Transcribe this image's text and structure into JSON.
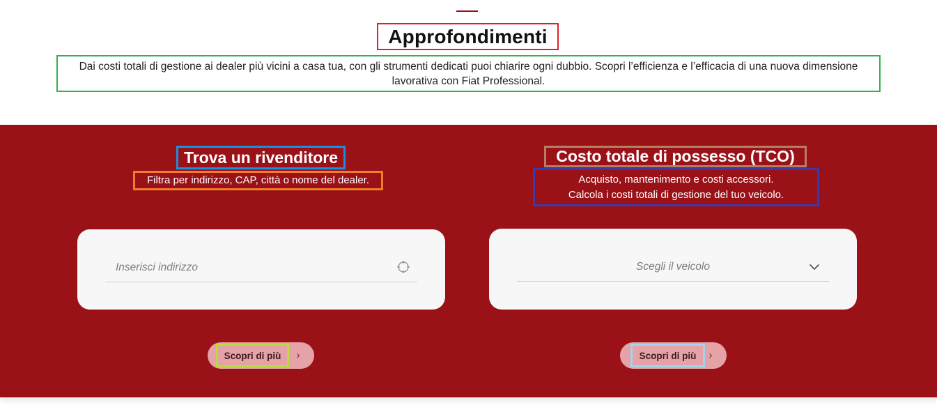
{
  "header": {
    "title": "Approfondimenti",
    "description": "Dai costi totali di gestione ai dealer più vicini a casa tua, con gli strumenti dedicati puoi chiarire ogni dubbio. Scopri l’efficienza e l’efficacia di una nuova dimensione lavorativa con Fiat Professional."
  },
  "dealer": {
    "title": "Trova un rivenditore",
    "subtitle": "Filtra per indirizzo, CAP, città o nome del dealer.",
    "address_placeholder": "Inserisci indirizzo",
    "locate_icon": "locate-crosshair-icon",
    "cta_label": "Scopri di più",
    "cta_arrow": "›"
  },
  "tco": {
    "title": "Costo totale di possesso (TCO)",
    "subtitle_line1": "Acquisto, mantenimento e costi accessori.",
    "subtitle_line2": "Calcola i costi totali di gestione del tuo veicolo.",
    "vehicle_select": "Scegli il veicolo",
    "chevron_icon": "chevron-down-icon",
    "cta_label": "Scopri di più",
    "cta_arrow": "›"
  },
  "colors": {
    "brand_red": "#9b1118",
    "button_bg": "#e5a3a7",
    "card_bg": "#f7f7f7"
  }
}
